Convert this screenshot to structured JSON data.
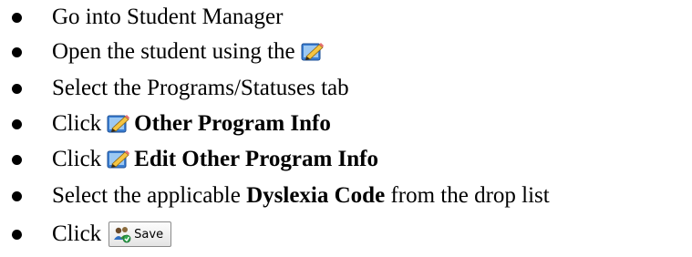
{
  "steps": [
    {
      "text": "Go into Student Manager"
    },
    {
      "text": "Open the student using the"
    },
    {
      "text": "Select the Programs/Statuses tab"
    },
    {
      "prefix": "Click",
      "bold": "Other Program Info"
    },
    {
      "prefix": "Click",
      "bold": "Edit Other Program Info"
    },
    {
      "prefix": "Select the applicable",
      "bold": "Dyslexia Code",
      "suffix": "from the drop list"
    },
    {
      "prefix": "Click",
      "button_label": "Save"
    }
  ]
}
